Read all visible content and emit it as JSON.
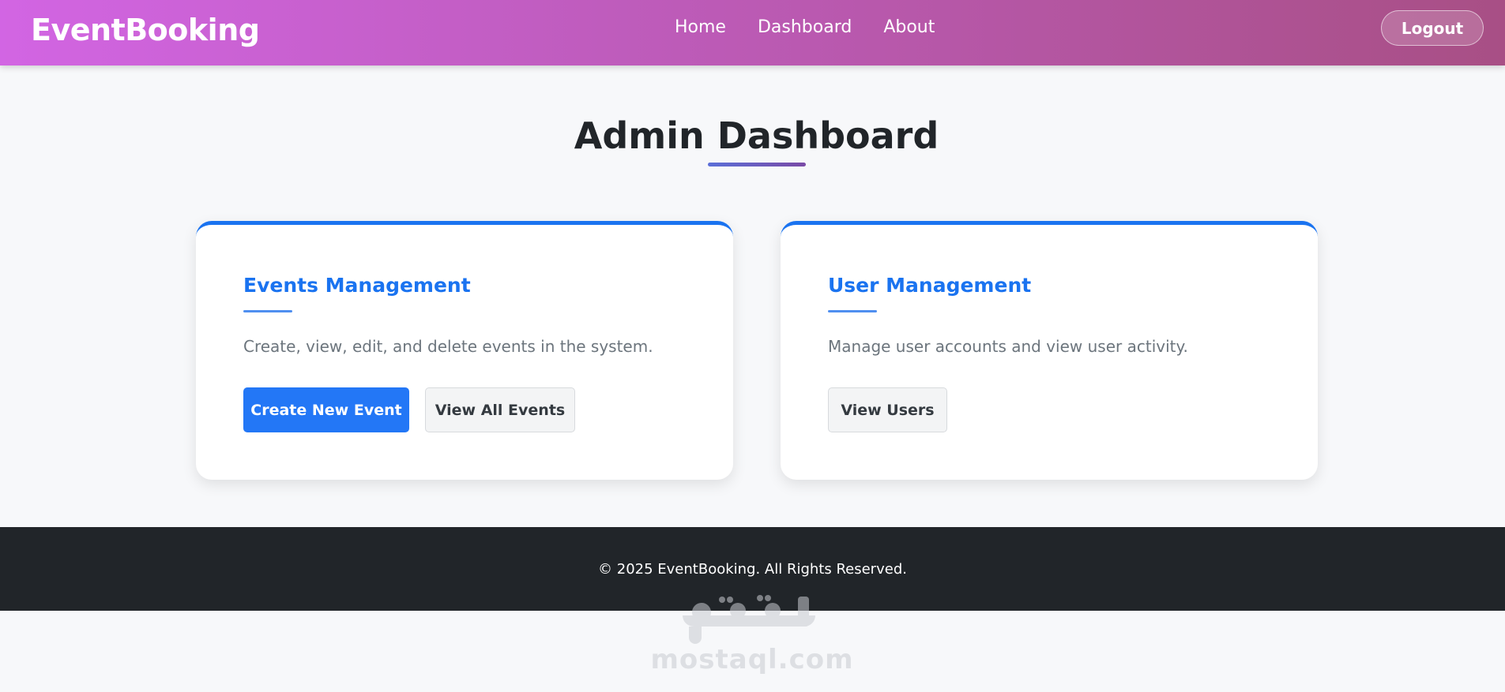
{
  "navbar": {
    "brand": "EventBooking",
    "links": [
      "Home",
      "Dashboard",
      "About"
    ],
    "logout_label": "Logout"
  },
  "main": {
    "title": "Admin Dashboard",
    "cards": [
      {
        "title": "Events Management",
        "description": "Create, view, edit, and delete events in the system.",
        "buttons": [
          "Create New Event",
          "View All Events"
        ]
      },
      {
        "title": "User Management",
        "description": "Manage user accounts and view user activity.",
        "buttons": [
          "View Users"
        ]
      }
    ]
  },
  "footer": {
    "text": "© 2025 EventBooking. All Rights Reserved."
  },
  "watermark": {
    "logo": "مستقل",
    "text": "mostaql.com"
  },
  "colors": {
    "accent": "#1a73f0",
    "primary_button": "#2377f6",
    "footer_bg": "#212529",
    "navbar_gradient_start": "#d265e3",
    "navbar_gradient_end": "#a84f85"
  }
}
